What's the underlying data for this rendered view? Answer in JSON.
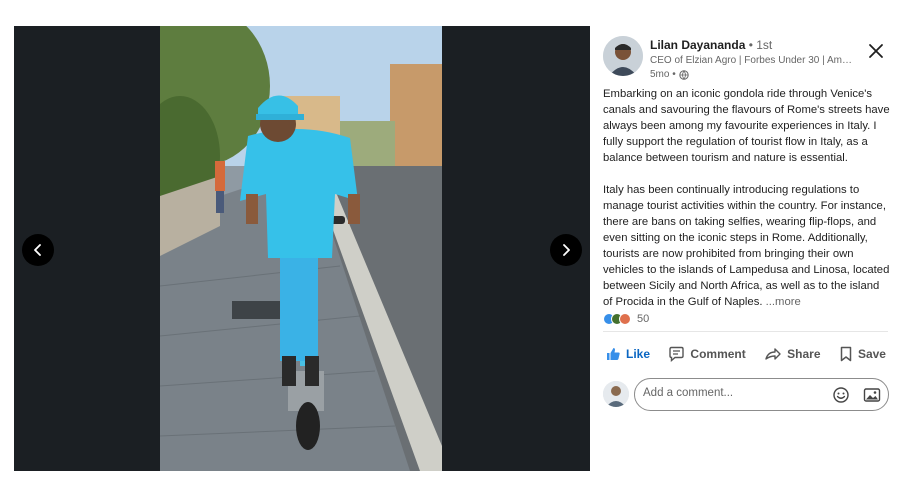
{
  "media": {
    "prev_icon": "chevron-left-icon",
    "next_icon": "chevron-right-icon",
    "photo_description_icon": "post-photo"
  },
  "post": {
    "author": {
      "name": "Lilan Dayananda",
      "degree": "• 1st",
      "headline": "CEO of Elzian Agro | Forbes Under 30 | Amon...",
      "time": "5mo •",
      "visibility_icon": "globe-icon"
    },
    "paragraphs": [
      "Embarking on an iconic gondola ride through Venice's canals and savouring the flavours of Rome's streets have always been among my favourite experiences in Italy. I fully support the regulation of tourist flow in Italy, as a balance between tourism and nature is essential.",
      "Italy has been continually introducing regulations to manage tourist activities within the country. For instance, there are bans on taking selfies, wearing flip-flops, and even sitting on the iconic steps in Rome. Additionally, tourists are now prohibited from bringing their own vehicles to the islands of Lampedusa and Linosa, located between Sicily and North Africa, as well as to the island of Procida in the Gulf of Naples."
    ],
    "more_label": "...more",
    "reaction_count": "50",
    "reaction_colors": [
      "#378fe9",
      "#44712e",
      "#df704d"
    ]
  },
  "actions": {
    "like": "Like",
    "comment": "Comment",
    "share": "Share",
    "save": "Save"
  },
  "comment_box": {
    "placeholder": "Add a comment..."
  },
  "colors": {
    "accent": "#0a66c2",
    "media_bg": "#1b1f23"
  }
}
